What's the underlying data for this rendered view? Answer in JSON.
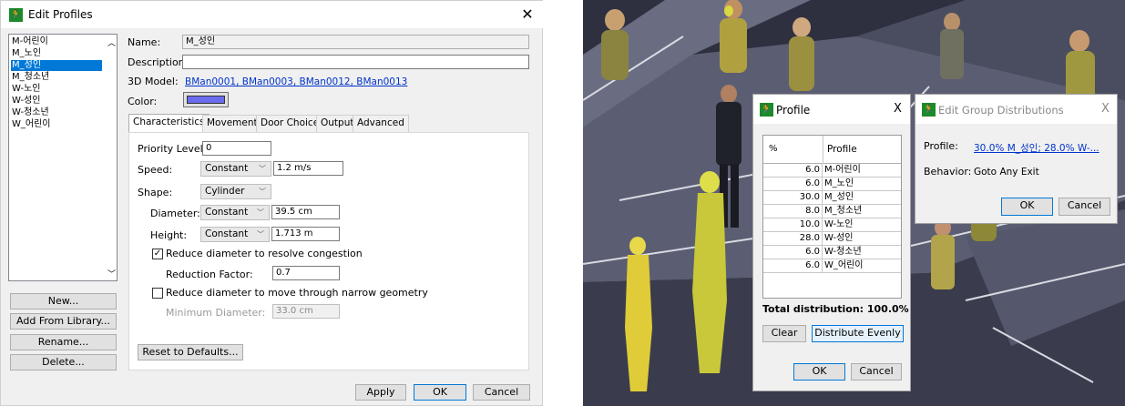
{
  "edit_profiles": {
    "title": "Edit Profiles",
    "close_glyph": "✕",
    "profiles": [
      "M-어린이",
      "M_노인",
      "M_성인",
      "M_청소년",
      "W-노인",
      "W-성인",
      "W-청소년",
      "W_어린이"
    ],
    "selected_profile": "M_성인",
    "labels": {
      "name": "Name:",
      "description": "Description:",
      "model": "3D Model:",
      "color": "Color:"
    },
    "name_value": "M_성인",
    "description_value": "",
    "model_value": "BMan0001, BMan0003, BMan0012, BMan0013",
    "color_value": "#6b6bf0",
    "tabs": [
      "Characteristics",
      "Movement",
      "Door Choice",
      "Output",
      "Advanced"
    ],
    "active_tab": "Characteristics",
    "characteristics": {
      "priority_label": "Priority Level:",
      "priority_value": "0",
      "speed_label": "Speed:",
      "speed_dist": "Constant",
      "speed_value": "1.2 m/s",
      "shape_label": "Shape:",
      "shape_value": "Cylinder",
      "diameter_label": "Diameter:",
      "diameter_dist": "Constant",
      "diameter_value": "39.5 cm",
      "height_label": "Height:",
      "height_dist": "Constant",
      "height_value": "1.713 m",
      "reduce_congestion_label": "Reduce diameter to resolve congestion",
      "reduce_congestion_checked": true,
      "reduction_factor_label": "Reduction Factor:",
      "reduction_factor_value": "0.7",
      "reduce_narrow_label": "Reduce diameter to move through narrow geometry",
      "reduce_narrow_checked": false,
      "min_diameter_label": "Minimum Diameter:",
      "min_diameter_value": "33.0 cm",
      "reset_label": "Reset to Defaults..."
    },
    "side_buttons": [
      "New...",
      "Add From Library...",
      "Rename...",
      "Delete..."
    ],
    "bottom_buttons": {
      "apply": "Apply",
      "ok": "OK",
      "cancel": "Cancel"
    }
  },
  "profile_dialog": {
    "title": "Profile",
    "close_glyph": "X",
    "headers": {
      "pct": "%",
      "profile": "Profile"
    },
    "rows": [
      {
        "pct": "6.0",
        "profile": "M-어린이"
      },
      {
        "pct": "6.0",
        "profile": "M_노인"
      },
      {
        "pct": "30.0",
        "profile": "M_성인"
      },
      {
        "pct": "8.0",
        "profile": "M_청소년"
      },
      {
        "pct": "10.0",
        "profile": "W-노인"
      },
      {
        "pct": "28.0",
        "profile": "W-성인"
      },
      {
        "pct": "6.0",
        "profile": "W-청소년"
      },
      {
        "pct": "6.0",
        "profile": "W_어린이"
      }
    ],
    "total_label": "Total distribution: 100.0%",
    "clear_label": "Clear",
    "distribute_label": "Distribute Evenly",
    "ok_label": "OK",
    "cancel_label": "Cancel"
  },
  "group_dialog": {
    "title": "Edit Group Distributions",
    "close_glyph": "X",
    "profile_label": "Profile:",
    "profile_value": "30.0% M_성인; 28.0% W-...",
    "behavior_label": "Behavior:",
    "behavior_value": "Goto Any Exit",
    "ok_label": "OK",
    "cancel_label": "Cancel"
  },
  "icons": {
    "app": "running-man-exit-icon"
  }
}
